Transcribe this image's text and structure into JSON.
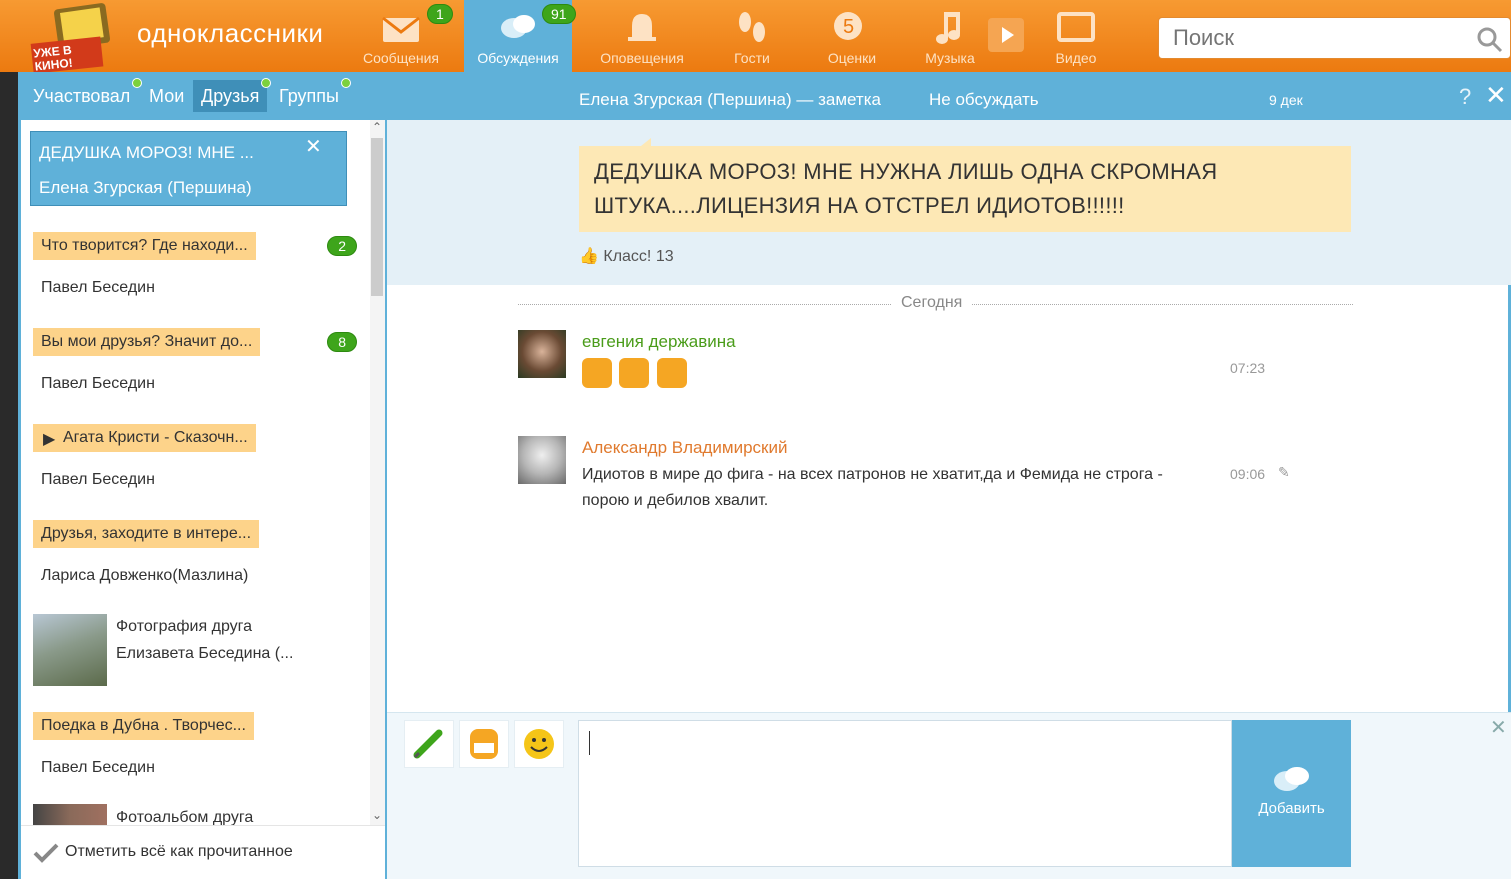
{
  "header": {
    "logo_text": "одноклассники",
    "promo": "УЖЕ В КИНО!",
    "nav": [
      {
        "label": "Сообщения",
        "badge": "1",
        "icon": "envelope-icon"
      },
      {
        "label": "Обсуждения",
        "badge": "91",
        "icon": "chat-bubbles-icon"
      },
      {
        "label": "Оповещения",
        "badge": "",
        "icon": "bell-icon"
      },
      {
        "label": "Гости",
        "badge": "",
        "icon": "footprints-icon"
      },
      {
        "label": "Оценки",
        "badge": "",
        "icon": "rating-five-icon"
      },
      {
        "label": "Музыка",
        "badge": "",
        "icon": "music-note-icon"
      },
      {
        "label": "Видео",
        "badge": "",
        "icon": "video-icon"
      }
    ],
    "search_placeholder": "Поиск"
  },
  "left_panel": {
    "tabs": [
      "Участвовал",
      "Мои",
      "Друзья",
      "Группы"
    ],
    "selected_tab": "Друзья",
    "conversations": [
      {
        "title": "ДЕДУШКА МОРОЗ! МНЕ ...",
        "author": "Елена Згурская (Першина)",
        "active": true
      },
      {
        "title": "Что творится? Где находи...",
        "author": "Павел Беседин",
        "badge": "2"
      },
      {
        "title": "Вы мои друзья? Значит до...",
        "author": "Павел Беседин",
        "badge": "8"
      },
      {
        "title": "Агата Кристи - Сказочн...",
        "author": "Павел Беседин"
      },
      {
        "title": "Друзья, заходите в интере...",
        "author": "Лариса Довженко(Мазлина)"
      },
      {
        "title": "Фотография друга",
        "author": "Елизавета Беседина (..."
      },
      {
        "title": "Поедка в Дубна . Творчес...",
        "author": "Павел Беседин"
      },
      {
        "title": "Фотоальбом друга",
        "author": ""
      }
    ],
    "mark_all_read": "Отметить всё как прочитанное"
  },
  "discussion": {
    "header_title": "Елена Згурская (Першина) — заметка",
    "no_discuss": "Не обсуждать",
    "date": "9 дек",
    "note_text": "ДЕДУШКА МОРОЗ! МНЕ НУЖНА ЛИШЬ ОДНА СКРОМНАЯ ШТУКА....ЛИЦЕНЗИЯ НА ОТСТРЕЛ ИДИОТОВ!!!!!!",
    "class_label": "Класс! 13",
    "today_label": "Сегодня",
    "messages": [
      {
        "name": "евгения державина",
        "time": "07:23",
        "text": "",
        "name_color": "#4a9c1a"
      },
      {
        "name": "Александр Владимирский",
        "time": "09:06",
        "text": "Идиотов в мире до фига - на всех патронов не хватит,да и Фемида не строга - порою и дебилов хвалит.",
        "name_color": "#e07a2e"
      }
    ],
    "add_button": "Добавить"
  }
}
